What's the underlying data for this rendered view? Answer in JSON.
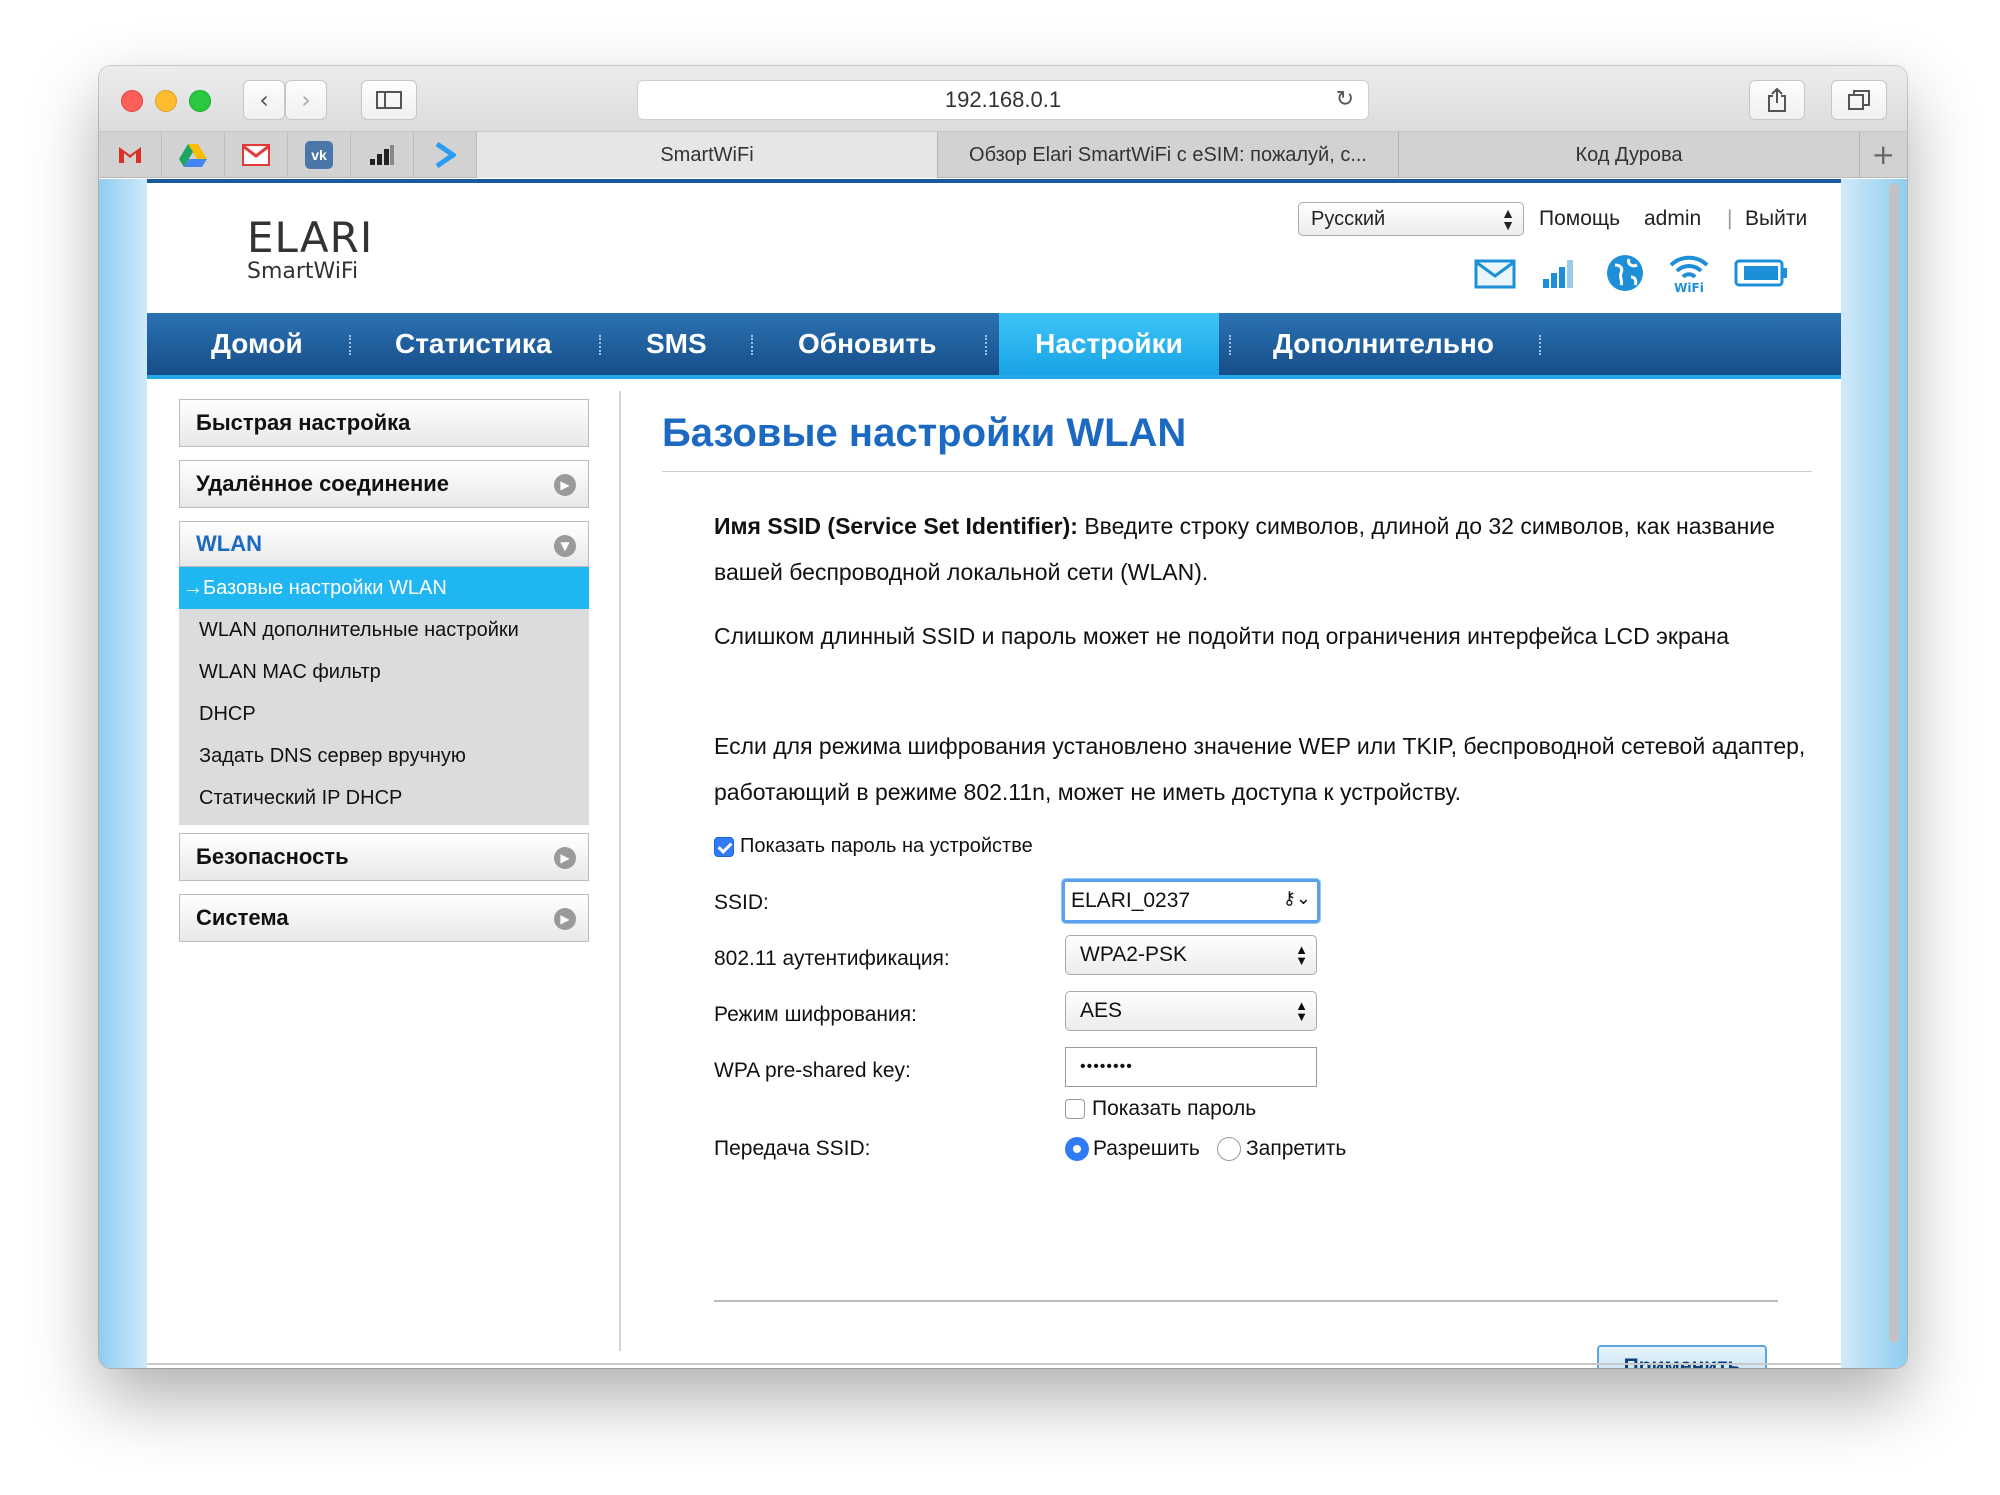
{
  "browser": {
    "address": "192.168.0.1",
    "tabs": [
      {
        "label": "SmartWiFi",
        "active": true
      },
      {
        "label": "Обзор Elari SmartWiFi с eSIM: пожалуй, с...",
        "active": false
      },
      {
        "label": "Код Дурова",
        "active": false
      }
    ],
    "favorites": [
      "gmail-icon",
      "google-drive-icon",
      "mail-icon",
      "vk-icon",
      "signal-bars-icon",
      "arrow-icon"
    ]
  },
  "header": {
    "logo_top": "ELARI",
    "logo_bottom": "SmartWiFi",
    "language": "Русский",
    "help": "Помощь",
    "user": "admin",
    "logout": "Выйти",
    "status_icons": [
      "mail-icon",
      "signal-icon",
      "globe-icon",
      "wifi-icon",
      "battery-icon"
    ],
    "brand_color": "#1b69c0"
  },
  "nav": {
    "items": [
      "Домой",
      "Статистика",
      "SMS",
      "Обновить",
      "Настройки",
      "Дополнительно"
    ],
    "active": "Настройки"
  },
  "sidebar": {
    "quick": "Быстрая настройка",
    "remote": "Удалённое соединение",
    "wlan": "WLAN",
    "sub": [
      "→Базовые настройки WLAN",
      "WLAN дополнительные настройки",
      "WLAN MAC фильтр",
      "DHCP",
      "Задать DNS сервер вручную",
      "Статический IP DHCP"
    ],
    "security": "Безопасность",
    "system": "Система"
  },
  "main": {
    "title": "Базовые настройки WLAN",
    "p1_bold": "Имя SSID (Service Set Identifier):",
    "p1_text": " Введите строку символов, длиной до 32 символов, как название вашей беспроводной локальной сети (WLAN).",
    "p2": "Слишком длинный SSID и пароль может не подойти под ограничения интерфейса LCD экрана",
    "p3": "Если для режима шифрования установлено значение WEP или TKIP, беспроводной сетевой адаптер, работающий в режиме 802.11n, может не иметь доступа к устройству.",
    "show_on_device": "Показать пароль на устройстве",
    "show_on_device_checked": true,
    "form": {
      "ssid_label": "SSID:",
      "ssid_value": "ELARI_0237",
      "auth_label": "802.11 аутентификация:",
      "auth_value": "WPA2-PSK",
      "enc_label": "Режим шифрования:",
      "enc_value": "AES",
      "psk_label": "WPA pre-shared key:",
      "psk_value": "••••••••",
      "show_pw": "Показать пароль",
      "show_pw_checked": false,
      "broadcast_label": "Передача SSID:",
      "allow": "Разрешить",
      "deny": "Запретить",
      "broadcast_value": "Разрешить"
    },
    "apply": "Применить"
  }
}
